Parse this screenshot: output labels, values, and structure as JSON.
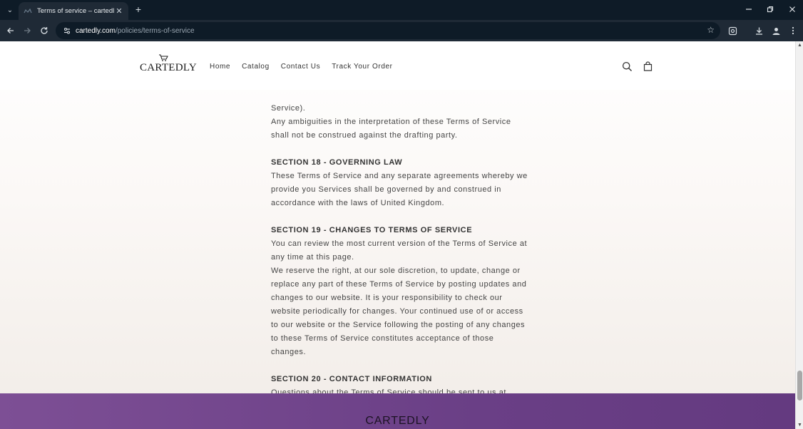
{
  "browser": {
    "tab_title": "Terms of service – cartedly",
    "url_host": "cartedly.com",
    "url_path": "/policies/terms-of-service"
  },
  "header": {
    "logo_text": "CARTEDLY",
    "nav": [
      "Home",
      "Catalog",
      "Contact Us",
      "Track Your Order"
    ]
  },
  "content": {
    "partial_line_top": "Service).",
    "para_ambiguities": "Any ambiguities in the interpretation of these Terms of Service shall not be construed against the drafting party.",
    "section18_title": "SECTION 18 - GOVERNING LAW",
    "section18_body": "These Terms of Service and any separate agreements whereby we provide you Services shall be governed by and construed in accordance with the laws of United Kingdom.",
    "section19_title": "SECTION 19 - CHANGES TO TERMS OF SERVICE",
    "section19_body1": "You can review the most current version of the Terms of Service at any time at this page.",
    "section19_body2": "We reserve the right, at our sole discretion, to update, change or replace any part of these Terms of Service by posting updates and changes to our website. It is your responsibility to check our website periodically for changes. Your continued use of or access to our website or the Service following the posting of any changes to these Terms of Service constitutes acceptance of those changes.",
    "section20_title": "SECTION 20 - CONTACT INFORMATION",
    "section20_body": "Questions about the Terms of Service should be sent to us at contact@cartedly.com."
  },
  "footer": {
    "title": "CARTEDLY"
  },
  "colors": {
    "footer_purple": "#6e4289",
    "text": "#444444",
    "chrome_dark": "#0e1b27"
  }
}
